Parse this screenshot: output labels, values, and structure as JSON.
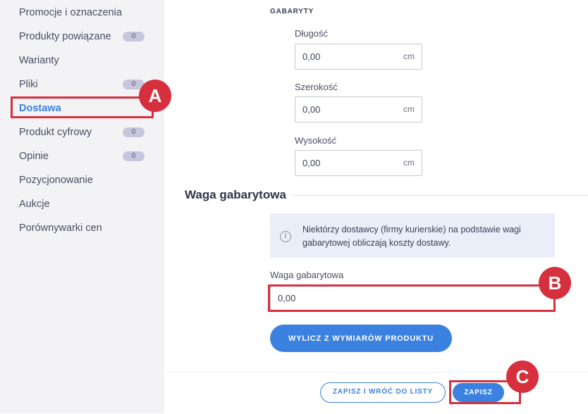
{
  "sidebar": {
    "items": [
      {
        "label": "Promocje i oznaczenia"
      },
      {
        "label": "Produkty powiązane",
        "badge": "0"
      },
      {
        "label": "Warianty"
      },
      {
        "label": "Pliki",
        "badge": "0"
      },
      {
        "label": "Dostawa",
        "active": true
      },
      {
        "label": "Produkt cyfrowy",
        "badge": "0"
      },
      {
        "label": "Opinie",
        "badge": "0"
      },
      {
        "label": "Pozycjonowanie"
      },
      {
        "label": "Aukcje"
      },
      {
        "label": "Porównywarki cen"
      }
    ]
  },
  "dimensions": {
    "section_label": "GABARYTY",
    "length": {
      "label": "Długość",
      "value": "0,00",
      "unit": "cm"
    },
    "width": {
      "label": "Szerokość",
      "value": "0,00",
      "unit": "cm"
    },
    "height": {
      "label": "Wysokość",
      "value": "0,00",
      "unit": "cm"
    }
  },
  "dim_weight": {
    "heading": "Waga gabarytowa",
    "info_text": "Niektórzy dostawcy (firmy kurierskie) na podstawie wagi gabarytowej obliczają koszty dostawy.",
    "field_label": "Waga gabarytowa",
    "field_value": "0,00",
    "calc_button": "WYLICZ Z WYMIARÓW PRODUKTU"
  },
  "footer": {
    "save_return_label": "ZAPISZ I WRÓĆ DO LISTY",
    "save_label": "ZAPISZ"
  },
  "annotations": {
    "a": "A",
    "b": "B",
    "c": "C",
    "color": "#d6303f"
  },
  "colors": {
    "accent": "#3b82e0",
    "badge": "#c8c6de",
    "info_bg": "#e9eef8"
  }
}
